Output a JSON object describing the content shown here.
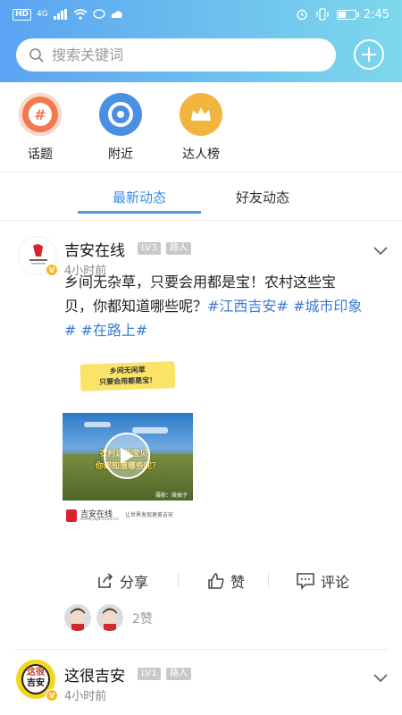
{
  "status_bar": {
    "left": [
      "HD",
      "4G",
      "signal",
      "wifi",
      "chat",
      "cloud"
    ],
    "time": "2:45"
  },
  "search": {
    "placeholder": "搜索关键词"
  },
  "quick_links": [
    {
      "label": "话题",
      "icon": "hashtag-icon",
      "color": "#f07a4e"
    },
    {
      "label": "附近",
      "icon": "camera-icon",
      "color": "#4a8fe3"
    },
    {
      "label": "达人榜",
      "icon": "crown-icon",
      "color": "#f1b43c"
    }
  ],
  "tabs": {
    "latest": "最新动态",
    "friends": "好友动态"
  },
  "posts": [
    {
      "user": "吉安在线",
      "level": "LV3",
      "role": "路人",
      "time": "4小时前",
      "text_lines": [
        "乡间无杂草，只要会用都是宝！农村这些宝",
        "贝，你都知道哪些呢？"
      ],
      "tags": [
        "#江西吉安#",
        "#城市印象",
        "#",
        "#在路上#"
      ],
      "media": {
        "banner_line1": "乡间无闲草",
        "banner_line2": "只要会用都是宝！",
        "overlay_line1": "农村这些宝贝，",
        "overlay_line2": "你都知道哪些呢？",
        "credit": "摄影：微振子",
        "brand": "吉安在线",
        "brand_url": "www.jaja.ccoo.cn",
        "slogan": "让世界发现更美吉安"
      },
      "actions": {
        "share": "分享",
        "like": "赞",
        "comment": "评论"
      },
      "likes": "2赞"
    },
    {
      "user": "这很吉安",
      "level": "LV1",
      "role": "路人",
      "time": "4小时前",
      "avatar_text_1": "这很",
      "avatar_text_2": "吉安"
    }
  ],
  "colors": {
    "accent": "#3b8de0",
    "tag": "#3d7bd6",
    "header_start": "#5aa3f2",
    "header_end": "#7dd8ec"
  }
}
